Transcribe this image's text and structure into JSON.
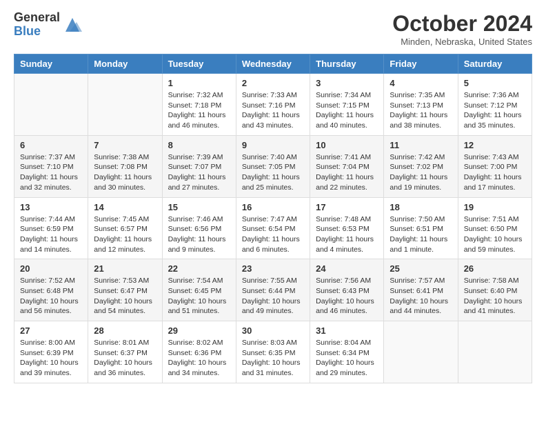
{
  "header": {
    "logo_general": "General",
    "logo_blue": "Blue",
    "month_title": "October 2024",
    "location": "Minden, Nebraska, United States"
  },
  "weekdays": [
    "Sunday",
    "Monday",
    "Tuesday",
    "Wednesday",
    "Thursday",
    "Friday",
    "Saturday"
  ],
  "weeks": [
    [
      {
        "day": null,
        "sunrise": null,
        "sunset": null,
        "daylight": null
      },
      {
        "day": null,
        "sunrise": null,
        "sunset": null,
        "daylight": null
      },
      {
        "day": "1",
        "sunrise": "Sunrise: 7:32 AM",
        "sunset": "Sunset: 7:18 PM",
        "daylight": "Daylight: 11 hours and 46 minutes."
      },
      {
        "day": "2",
        "sunrise": "Sunrise: 7:33 AM",
        "sunset": "Sunset: 7:16 PM",
        "daylight": "Daylight: 11 hours and 43 minutes."
      },
      {
        "day": "3",
        "sunrise": "Sunrise: 7:34 AM",
        "sunset": "Sunset: 7:15 PM",
        "daylight": "Daylight: 11 hours and 40 minutes."
      },
      {
        "day": "4",
        "sunrise": "Sunrise: 7:35 AM",
        "sunset": "Sunset: 7:13 PM",
        "daylight": "Daylight: 11 hours and 38 minutes."
      },
      {
        "day": "5",
        "sunrise": "Sunrise: 7:36 AM",
        "sunset": "Sunset: 7:12 PM",
        "daylight": "Daylight: 11 hours and 35 minutes."
      }
    ],
    [
      {
        "day": "6",
        "sunrise": "Sunrise: 7:37 AM",
        "sunset": "Sunset: 7:10 PM",
        "daylight": "Daylight: 11 hours and 32 minutes."
      },
      {
        "day": "7",
        "sunrise": "Sunrise: 7:38 AM",
        "sunset": "Sunset: 7:08 PM",
        "daylight": "Daylight: 11 hours and 30 minutes."
      },
      {
        "day": "8",
        "sunrise": "Sunrise: 7:39 AM",
        "sunset": "Sunset: 7:07 PM",
        "daylight": "Daylight: 11 hours and 27 minutes."
      },
      {
        "day": "9",
        "sunrise": "Sunrise: 7:40 AM",
        "sunset": "Sunset: 7:05 PM",
        "daylight": "Daylight: 11 hours and 25 minutes."
      },
      {
        "day": "10",
        "sunrise": "Sunrise: 7:41 AM",
        "sunset": "Sunset: 7:04 PM",
        "daylight": "Daylight: 11 hours and 22 minutes."
      },
      {
        "day": "11",
        "sunrise": "Sunrise: 7:42 AM",
        "sunset": "Sunset: 7:02 PM",
        "daylight": "Daylight: 11 hours and 19 minutes."
      },
      {
        "day": "12",
        "sunrise": "Sunrise: 7:43 AM",
        "sunset": "Sunset: 7:00 PM",
        "daylight": "Daylight: 11 hours and 17 minutes."
      }
    ],
    [
      {
        "day": "13",
        "sunrise": "Sunrise: 7:44 AM",
        "sunset": "Sunset: 6:59 PM",
        "daylight": "Daylight: 11 hours and 14 minutes."
      },
      {
        "day": "14",
        "sunrise": "Sunrise: 7:45 AM",
        "sunset": "Sunset: 6:57 PM",
        "daylight": "Daylight: 11 hours and 12 minutes."
      },
      {
        "day": "15",
        "sunrise": "Sunrise: 7:46 AM",
        "sunset": "Sunset: 6:56 PM",
        "daylight": "Daylight: 11 hours and 9 minutes."
      },
      {
        "day": "16",
        "sunrise": "Sunrise: 7:47 AM",
        "sunset": "Sunset: 6:54 PM",
        "daylight": "Daylight: 11 hours and 6 minutes."
      },
      {
        "day": "17",
        "sunrise": "Sunrise: 7:48 AM",
        "sunset": "Sunset: 6:53 PM",
        "daylight": "Daylight: 11 hours and 4 minutes."
      },
      {
        "day": "18",
        "sunrise": "Sunrise: 7:50 AM",
        "sunset": "Sunset: 6:51 PM",
        "daylight": "Daylight: 11 hours and 1 minute."
      },
      {
        "day": "19",
        "sunrise": "Sunrise: 7:51 AM",
        "sunset": "Sunset: 6:50 PM",
        "daylight": "Daylight: 10 hours and 59 minutes."
      }
    ],
    [
      {
        "day": "20",
        "sunrise": "Sunrise: 7:52 AM",
        "sunset": "Sunset: 6:48 PM",
        "daylight": "Daylight: 10 hours and 56 minutes."
      },
      {
        "day": "21",
        "sunrise": "Sunrise: 7:53 AM",
        "sunset": "Sunset: 6:47 PM",
        "daylight": "Daylight: 10 hours and 54 minutes."
      },
      {
        "day": "22",
        "sunrise": "Sunrise: 7:54 AM",
        "sunset": "Sunset: 6:45 PM",
        "daylight": "Daylight: 10 hours and 51 minutes."
      },
      {
        "day": "23",
        "sunrise": "Sunrise: 7:55 AM",
        "sunset": "Sunset: 6:44 PM",
        "daylight": "Daylight: 10 hours and 49 minutes."
      },
      {
        "day": "24",
        "sunrise": "Sunrise: 7:56 AM",
        "sunset": "Sunset: 6:43 PM",
        "daylight": "Daylight: 10 hours and 46 minutes."
      },
      {
        "day": "25",
        "sunrise": "Sunrise: 7:57 AM",
        "sunset": "Sunset: 6:41 PM",
        "daylight": "Daylight: 10 hours and 44 minutes."
      },
      {
        "day": "26",
        "sunrise": "Sunrise: 7:58 AM",
        "sunset": "Sunset: 6:40 PM",
        "daylight": "Daylight: 10 hours and 41 minutes."
      }
    ],
    [
      {
        "day": "27",
        "sunrise": "Sunrise: 8:00 AM",
        "sunset": "Sunset: 6:39 PM",
        "daylight": "Daylight: 10 hours and 39 minutes."
      },
      {
        "day": "28",
        "sunrise": "Sunrise: 8:01 AM",
        "sunset": "Sunset: 6:37 PM",
        "daylight": "Daylight: 10 hours and 36 minutes."
      },
      {
        "day": "29",
        "sunrise": "Sunrise: 8:02 AM",
        "sunset": "Sunset: 6:36 PM",
        "daylight": "Daylight: 10 hours and 34 minutes."
      },
      {
        "day": "30",
        "sunrise": "Sunrise: 8:03 AM",
        "sunset": "Sunset: 6:35 PM",
        "daylight": "Daylight: 10 hours and 31 minutes."
      },
      {
        "day": "31",
        "sunrise": "Sunrise: 8:04 AM",
        "sunset": "Sunset: 6:34 PM",
        "daylight": "Daylight: 10 hours and 29 minutes."
      },
      {
        "day": null,
        "sunrise": null,
        "sunset": null,
        "daylight": null
      },
      {
        "day": null,
        "sunrise": null,
        "sunset": null,
        "daylight": null
      }
    ]
  ]
}
